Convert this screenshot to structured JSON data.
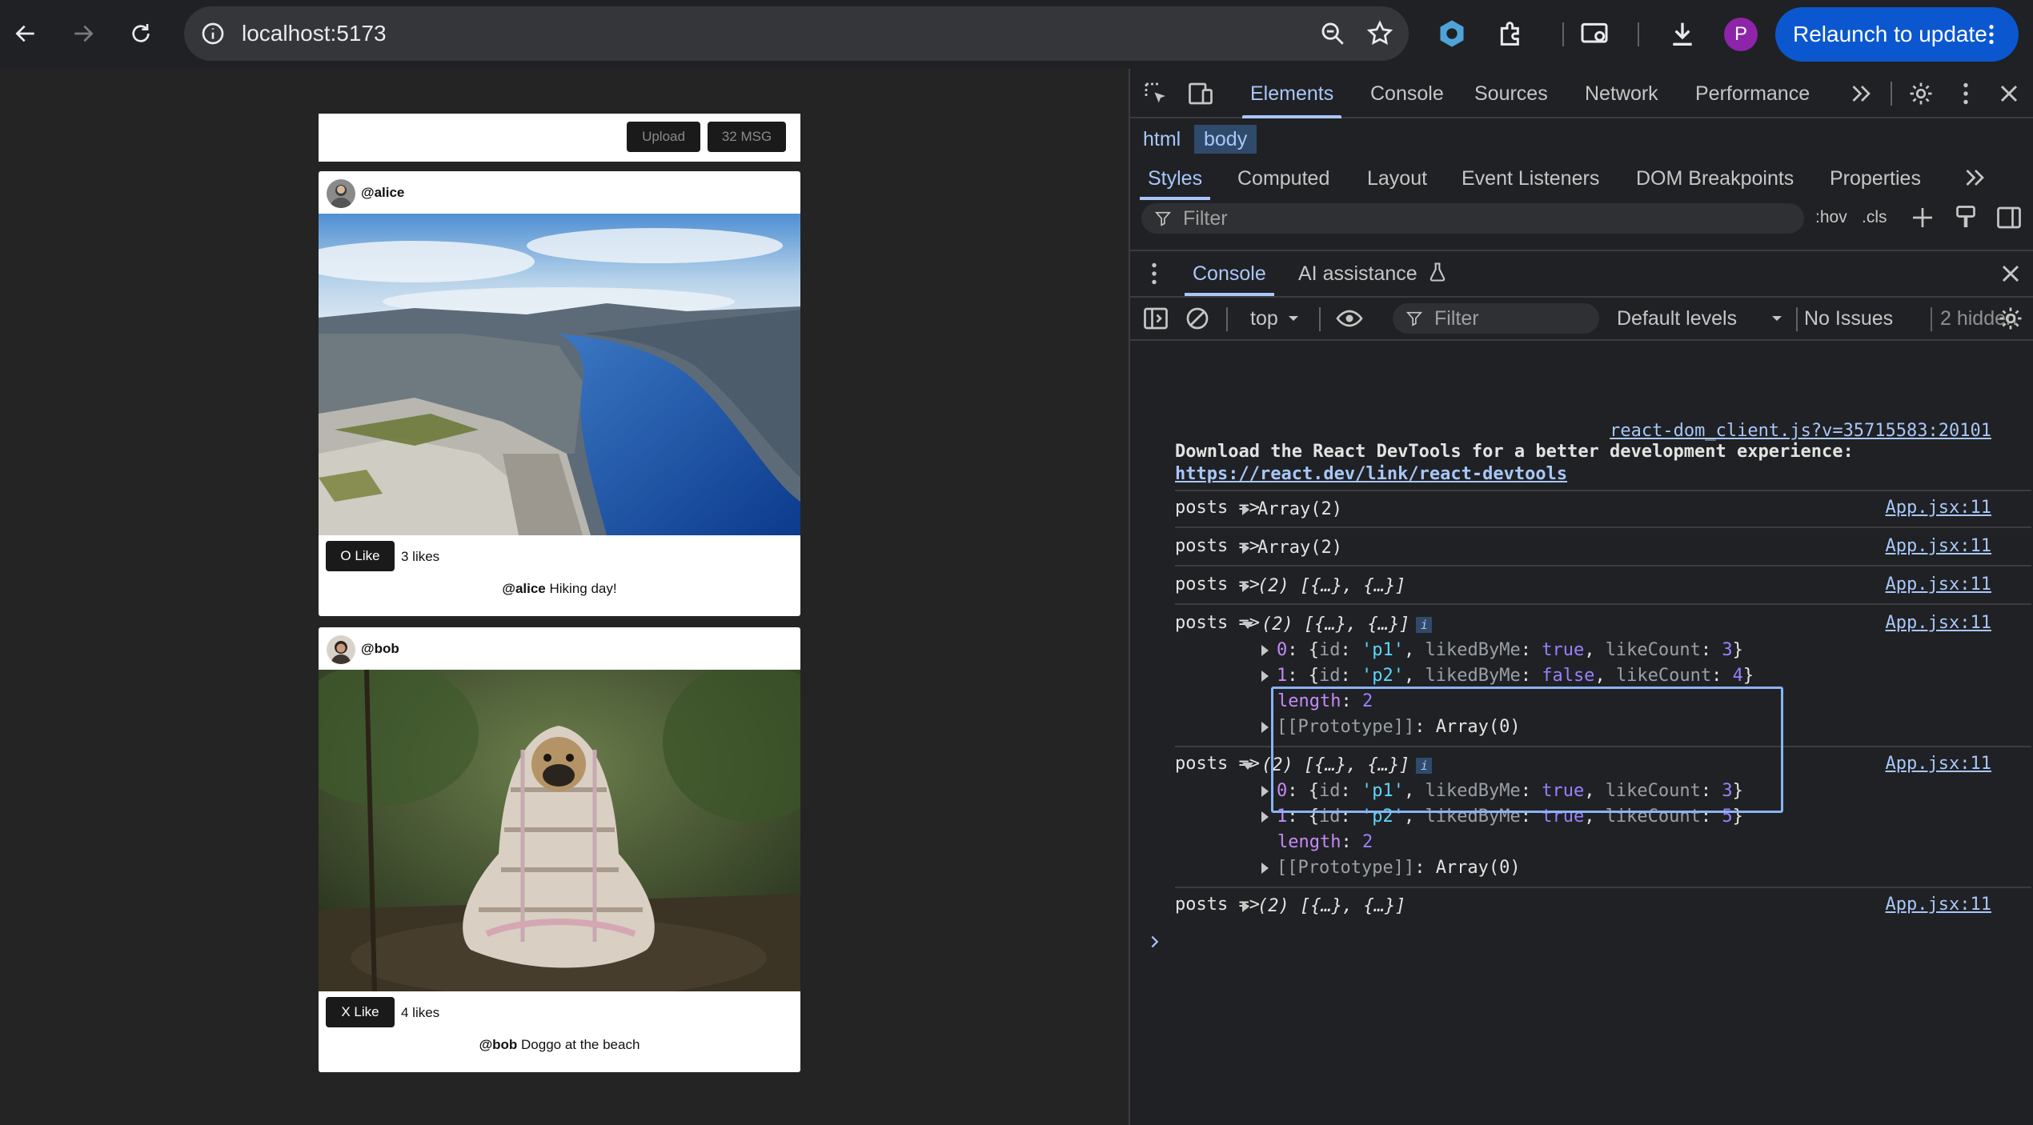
{
  "browser": {
    "url": "localhost:5173",
    "profile_initial": "P",
    "relaunch_label": "Relaunch to update",
    "icons": [
      "back-icon",
      "forward-icon",
      "reload-icon",
      "info-icon",
      "zoom-icon",
      "star-icon",
      "extension-icon",
      "puzzle-icon",
      "cast-icon",
      "download-icon",
      "menu-icon"
    ]
  },
  "page": {
    "upload_label": "Upload",
    "msg_label": "32 MSG",
    "posts": [
      {
        "user": "@alice",
        "like_label": "O Like",
        "likes": "3 likes",
        "caption_user": "@alice",
        "caption_text": "Hiking day!"
      },
      {
        "user": "@bob",
        "like_label": "X Like",
        "likes": "4 likes",
        "caption_user": "@bob",
        "caption_text": "Doggo at the beach"
      }
    ]
  },
  "devtools": {
    "tabs": [
      "Elements",
      "Console",
      "Sources",
      "Network",
      "Performance"
    ],
    "active_tab": "Elements",
    "breadcrumbs": [
      "html",
      "body"
    ],
    "subtabs": [
      "Styles",
      "Computed",
      "Layout",
      "Event Listeners",
      "DOM Breakpoints",
      "Properties"
    ],
    "filter_placeholder": "Filter",
    "hov": ":hov",
    "cls": ".cls",
    "drawer_tabs": [
      "Console",
      "AI assistance"
    ],
    "console_toolbar": {
      "context": "top",
      "filter_placeholder": "Filter",
      "levels": "Default levels",
      "issues": "No Issues",
      "hidden": "2 hidden"
    },
    "log": {
      "react_src": "react-dom_client.js?v=35715583:20101",
      "react_msg": "Download the React DevTools for a better development experience:",
      "react_link": "https://react.dev/link/react-devtools",
      "app_src": "App.jsx:11",
      "label": "posts =>",
      "array2": "Array(2)",
      "collapsed": "(2) [{…}, {…}]",
      "info": "i",
      "expanded_1": {
        "item0": {
          "id": "'p1'",
          "likedByMe": "true",
          "likeCount": "3"
        },
        "item1": {
          "id": "'p2'",
          "likedByMe": "false",
          "likeCount": "4"
        }
      },
      "expanded_2": {
        "item0": {
          "id": "'p1'",
          "likedByMe": "true",
          "likeCount": "3"
        },
        "item1": {
          "id": "'p2'",
          "likedByMe": "true",
          "likeCount": "5"
        }
      },
      "length_label": "length",
      "length_value": "2",
      "proto_label": "[[Prototype]]",
      "proto_value": "Array(0)"
    }
  }
}
